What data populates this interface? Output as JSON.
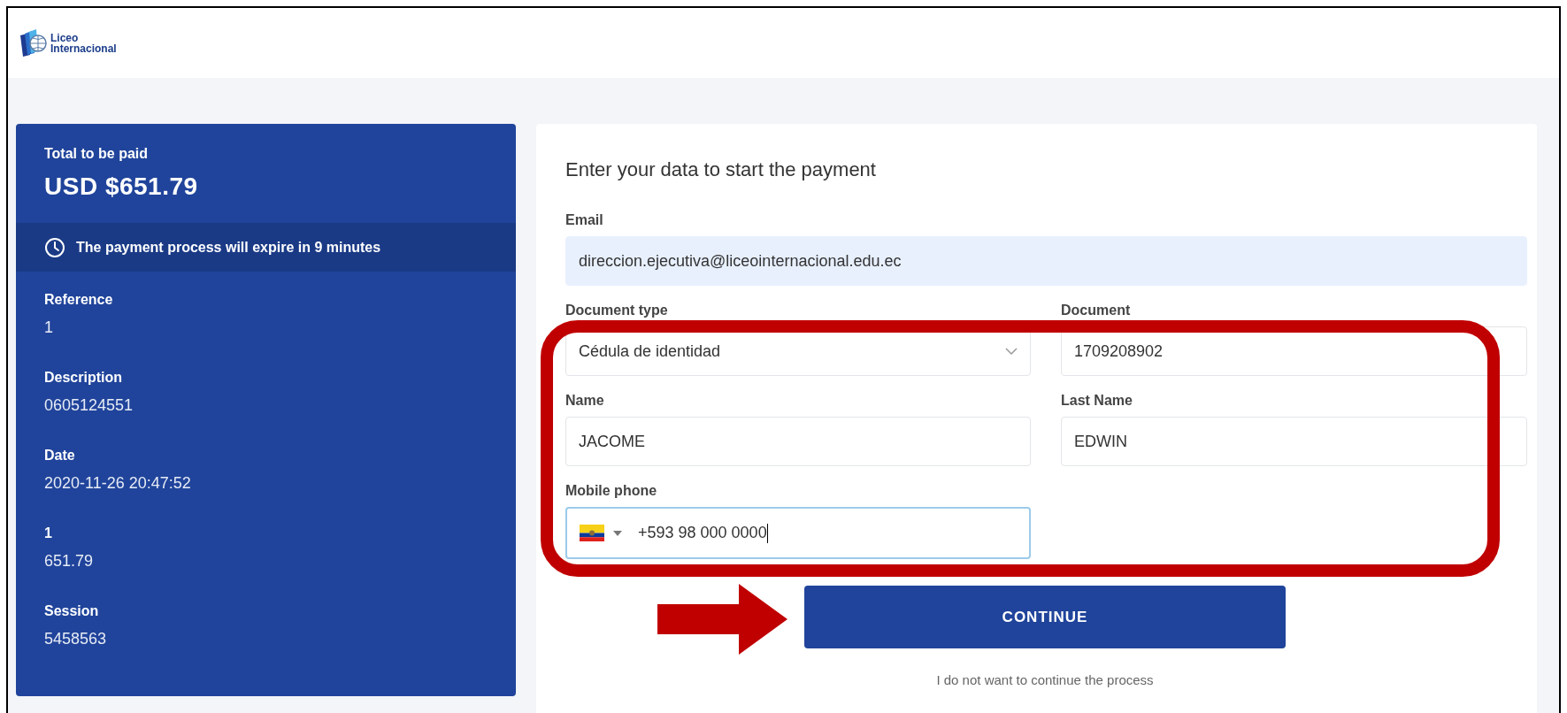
{
  "header": {
    "logo": [
      "Liceo",
      "Internacional"
    ]
  },
  "summary": {
    "total_label": "Total to be paid",
    "total_amount": "USD $651.79",
    "expiry_notice": "The payment process will expire in 9 minutes",
    "details": [
      {
        "label": "Reference",
        "value": "1"
      },
      {
        "label": "Description",
        "value": "0605124551"
      },
      {
        "label": "Date",
        "value": "2020-11-26 20:47:52"
      },
      {
        "label": "1",
        "value": "651.79"
      },
      {
        "label": "Session",
        "value": "5458563"
      }
    ]
  },
  "form": {
    "title": "Enter your data to start the payment",
    "fields": [
      {
        "kind": "email",
        "label": "Email",
        "value": "direccion.ejecutiva@liceointernacional.edu.ec",
        "focused": false
      },
      {
        "kind": "select",
        "label": "Document type",
        "value": "Cédula de identidad",
        "focused": false
      },
      {
        "kind": "text",
        "label": "Document",
        "value": "1709208902",
        "focused": false
      },
      {
        "kind": "text",
        "label": "Name",
        "value": "JACOME",
        "focused": false
      },
      {
        "kind": "text",
        "label": "Last Name",
        "value": "EDWIN",
        "focused": false
      },
      {
        "kind": "phone",
        "label": "Mobile phone",
        "value": "+593 98 000 0000",
        "focused": true
      }
    ],
    "continue_button": "CONTINUE",
    "cancel_link": "I do not want to continue the process"
  },
  "annotations": {
    "highlight_outline": true,
    "pointer_arrow": true
  }
}
